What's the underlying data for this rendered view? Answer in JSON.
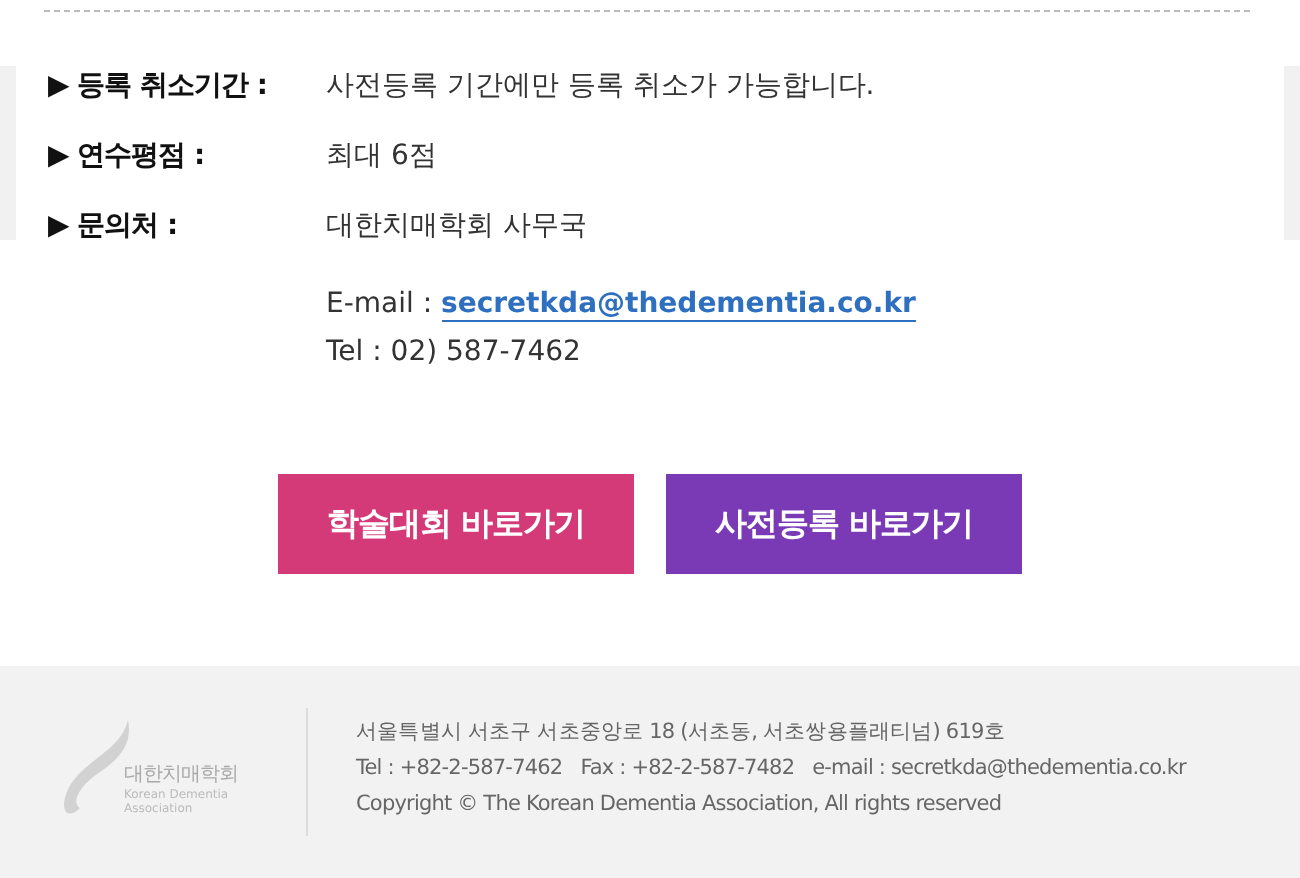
{
  "info_rows": [
    {
      "label": "▶ 등록 취소기간 :",
      "lines": [
        "사전등록 기간에만 등록 취소가 가능합니다."
      ]
    },
    {
      "label": "▶ 연수평점 :",
      "lines": [
        "최대 6점"
      ]
    },
    {
      "label": "▶ 문의처 :",
      "lines": [
        "대한치매학회 사무국"
      ]
    }
  ],
  "contact": {
    "email_label": "E-mail :",
    "email": "secretkda@thedementia.co.kr",
    "tel": "Tel : 02) 587-7462"
  },
  "buttons": [
    {
      "label": "학술대회 바로가기",
      "color": "#d33a77"
    },
    {
      "label": "사전등록 바로가기",
      "color": "#7a3ab6"
    }
  ],
  "footer": {
    "logo_name": "대한치매학회",
    "logo_english": "Korean Dementia Association",
    "address": "서울특별시 서초구 서초중앙로 18 (서초동, 서초쌍용플래티넘) 619호",
    "contacts": [
      "Tel : +82-2-587-7462",
      "Fax : +82-2-587-7482",
      "e-mail : secretkda@thedementia.co.kr"
    ],
    "copyright": "Copyright © The Korean Dementia Association, All rights reserved"
  }
}
